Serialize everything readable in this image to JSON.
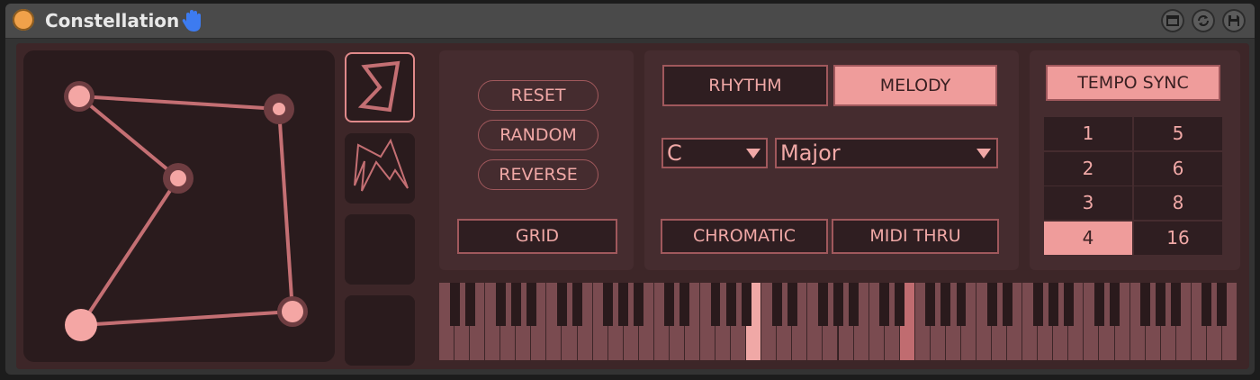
{
  "title": "Constellation",
  "icons": {
    "power": "power-button-icon",
    "hand": "hand-icon",
    "window": "window-icon",
    "sync": "sync-icon",
    "save": "save-icon"
  },
  "colors": {
    "accent": "#ef9c9b",
    "node": "#f4a6a4",
    "background": "#3d2628",
    "panel": "#452c2f"
  },
  "shapes": [
    "shape-preset-sigma",
    "shape-preset-zigzag",
    "shape-preset-empty-1",
    "shape-preset-empty-2"
  ],
  "controls": {
    "reset": "RESET",
    "random": "RANDOM",
    "reverse": "REVERSE",
    "grid": "GRID"
  },
  "mode": {
    "rhythm": "RHYTHM",
    "melody": "MELODY",
    "active": "MELODY"
  },
  "scale": {
    "root": "C",
    "type": "Major"
  },
  "options": {
    "chromatic": "CHROMATIC",
    "midi_thru": "MIDI THRU"
  },
  "tempo": {
    "sync_label": "TEMPO SYNC",
    "left_column": [
      "1",
      "2",
      "3",
      "4"
    ],
    "right_column": [
      "5",
      "6",
      "8",
      "16"
    ],
    "selected": "4"
  },
  "keyboard": {
    "white_keys": 52,
    "highlighted_keys": [
      20,
      30
    ]
  }
}
